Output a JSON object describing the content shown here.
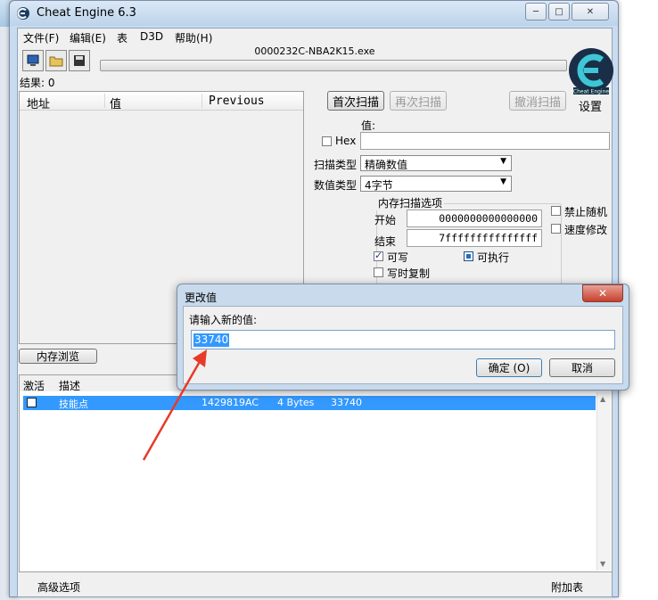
{
  "window": {
    "title": "Cheat Engine 6.3",
    "minimize": "─",
    "maximize": "□",
    "close": "✕"
  },
  "menu": [
    {
      "label": "文件(F)"
    },
    {
      "label": "编辑(E)"
    },
    {
      "label": "表"
    },
    {
      "label": "D3D"
    },
    {
      "label": "帮助(H)"
    }
  ],
  "process_name": "0000232C-NBA2K15.exe",
  "results_label": "结果: 0",
  "address_list": {
    "columns": [
      "地址",
      "值",
      "Previous"
    ]
  },
  "scan": {
    "first_scan": "首次扫描",
    "next_scan": "再次扫描",
    "undo_scan": "撤消扫描",
    "value_label": "值:",
    "hex_label": "Hex",
    "scan_type_label": "扫描类型",
    "scan_type_value": "精确数值",
    "value_type_label": "数值类型",
    "value_type_value": "4字节",
    "memory_options_title": "内存扫描选项",
    "start_label": "开始",
    "start_value": "0000000000000000",
    "stop_label": "结束",
    "stop_value": "7fffffffffffffff",
    "writable": "可写",
    "executable": "可执行",
    "copy_on_write": "写时复制",
    "disable_random": "禁止随机",
    "speedhack": "速度修改",
    "settings": "设置",
    "logo_text": "Cheat Engine"
  },
  "memory_view_button": "内存浏览",
  "cheat_table": {
    "col_active": "激活",
    "col_desc": "描述",
    "rows": [
      {
        "description": "技能点",
        "address": "1429819AC",
        "type": "4 Bytes",
        "value": "33740"
      }
    ]
  },
  "status": {
    "advanced": "高级选项",
    "extras": "附加表"
  },
  "dialog": {
    "title": "更改值",
    "prompt": "请输入新的值:",
    "input_value": "33740",
    "ok": "确定 (O)",
    "cancel": "取消"
  },
  "colors": {
    "selection": "#3399ff",
    "annotation_arrow": "#e83a2a",
    "window_frame": "#c9dcef"
  }
}
